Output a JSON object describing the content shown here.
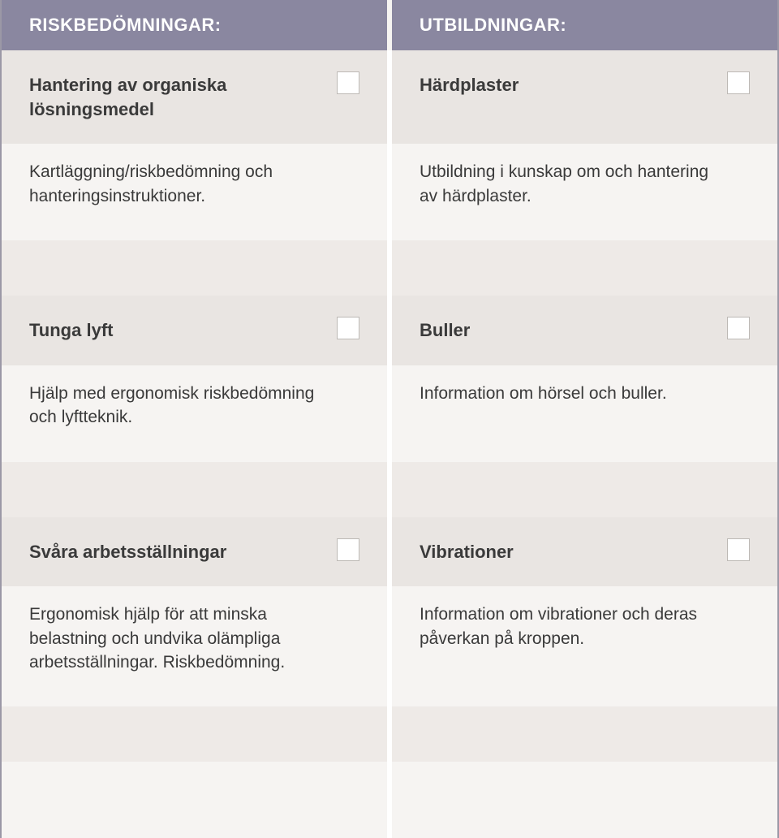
{
  "headers": {
    "left": "RISKBEDÖMNINGAR:",
    "right": "UTBILDNINGAR:"
  },
  "rows": [
    {
      "left": {
        "title": "Hantering av organiska lösningsmedel",
        "desc": "Kartläggning/riskbedömning och hanteringsinstruktioner."
      },
      "right": {
        "title": "Härdplaster",
        "desc": "Utbildning i kunskap om och hantering av härdplaster."
      }
    },
    {
      "left": {
        "title": "Tunga lyft",
        "desc": "Hjälp med ergonomisk riskbedömning och lyftteknik."
      },
      "right": {
        "title": "Buller",
        "desc": "Information om hörsel och buller."
      }
    },
    {
      "left": {
        "title": "Svåra arbetsställningar",
        "desc": "Ergonomisk hjälp för att minska belastning och undvika olämpliga arbetsställningar. Riskbedömning."
      },
      "right": {
        "title": "Vibrationer",
        "desc": "Information om vibrationer och deras påverkan på kroppen."
      }
    }
  ]
}
